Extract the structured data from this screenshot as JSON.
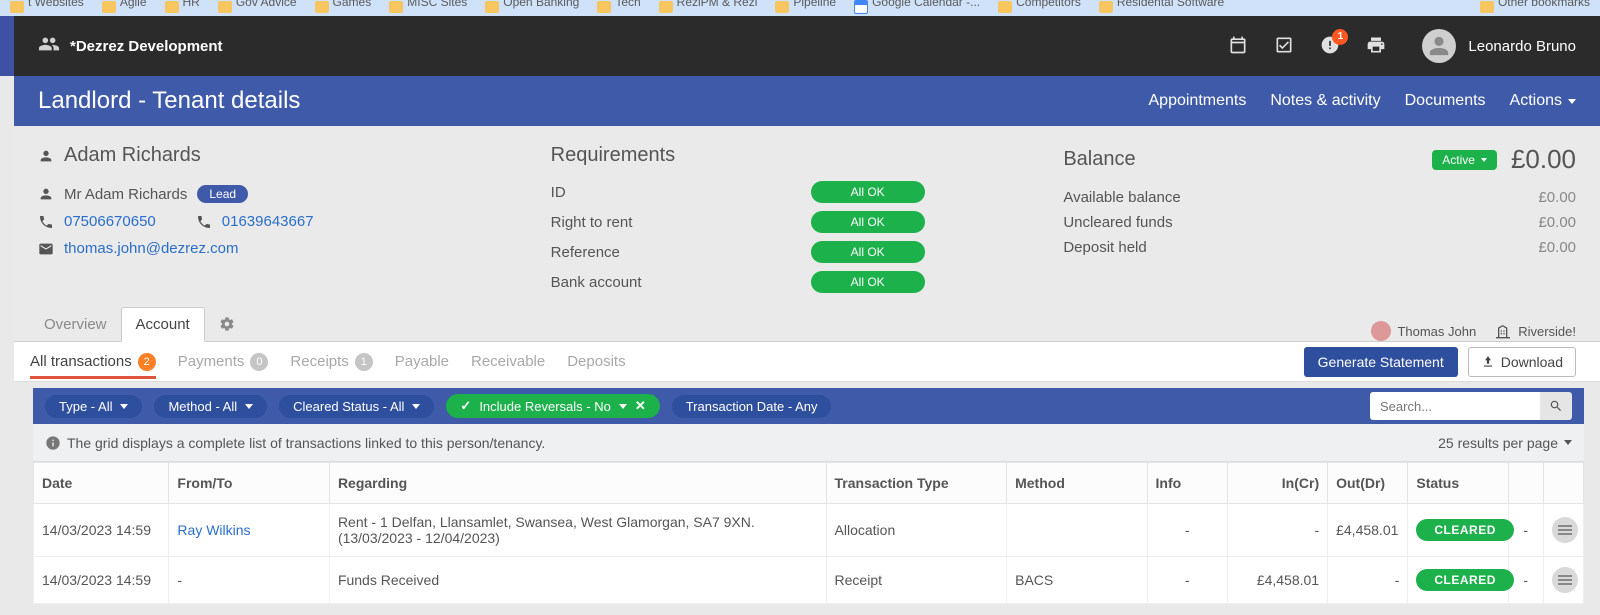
{
  "bookmarks": {
    "left": [
      {
        "label": "t Websites"
      },
      {
        "label": "Agile"
      },
      {
        "label": "HR"
      },
      {
        "label": "Gov Advice"
      },
      {
        "label": "Games"
      },
      {
        "label": "MISC Sites"
      },
      {
        "label": "Open Banking"
      },
      {
        "label": "Tech"
      },
      {
        "label": "ReziPM & Rezi"
      },
      {
        "label": "Pipeline"
      },
      {
        "label": "Google Calendar -...",
        "icon": "calendar"
      },
      {
        "label": "Competitors"
      },
      {
        "label": "Residental Software"
      }
    ],
    "right": [
      {
        "label": "Other bookmarks"
      }
    ]
  },
  "header": {
    "brand": "*Dezrez Development",
    "notif_count": "1",
    "user_name": "Leonardo Bruno"
  },
  "titlebar": {
    "title": "Landlord - Tenant details",
    "actions": {
      "appointments": "Appointments",
      "notes": "Notes & activity",
      "documents": "Documents",
      "actions": "Actions"
    }
  },
  "contact": {
    "name": "Adam Richards",
    "full_name": "Mr Adam Richards",
    "lead_label": "Lead",
    "phone1": "07506670650",
    "phone2": "01639643667",
    "email": "thomas.john@dezrez.com"
  },
  "requirements": {
    "title": "Requirements",
    "rows": [
      {
        "label": "ID",
        "status": "All OK"
      },
      {
        "label": "Right to rent",
        "status": "All OK"
      },
      {
        "label": "Reference",
        "status": "All OK"
      },
      {
        "label": "Bank account",
        "status": "All OK"
      }
    ]
  },
  "balance": {
    "title": "Balance",
    "active_label": "Active",
    "amount": "£0.00",
    "rows": [
      {
        "label": "Available balance",
        "value": "£0.00"
      },
      {
        "label": "Uncleared funds",
        "value": "£0.00"
      },
      {
        "label": "Deposit held",
        "value": "£0.00"
      }
    ]
  },
  "tabs": {
    "overview": "Overview",
    "account": "Account",
    "right_user": "Thomas John",
    "right_office": "Riverside!"
  },
  "subtabs": {
    "all": {
      "label": "All transactions",
      "count": "2"
    },
    "payments": {
      "label": "Payments",
      "count": "0"
    },
    "receipts": {
      "label": "Receipts",
      "count": "1"
    },
    "payable": {
      "label": "Payable"
    },
    "receivable": {
      "label": "Receivable"
    },
    "deposits": {
      "label": "Deposits"
    },
    "generate_btn": "Generate Statement",
    "download_btn": "Download"
  },
  "filters": {
    "type": "Type - All",
    "method": "Method - All",
    "cleared": "Cleared Status - All",
    "reversals": "Include Reversals - No",
    "date": "Transaction Date - Any",
    "search_placeholder": "Search..."
  },
  "grid_info": {
    "text": "The grid displays a complete list of transactions linked to this person/tenancy.",
    "rpp": "25 results per page"
  },
  "table": {
    "headers": {
      "date": "Date",
      "from": "From/To",
      "regarding": "Regarding",
      "type": "Transaction Type",
      "method": "Method",
      "info": "Info",
      "in": "In(Cr)",
      "out": "Out(Dr)",
      "status": "Status"
    },
    "rows": [
      {
        "date": "14/03/2023 14:59",
        "from": "Ray Wilkins",
        "from_link": true,
        "regarding": "Rent - 1 Delfan, Llansamlet, Swansea, West Glamorgan, SA7 9XN. (13/03/2023 - 12/04/2023)",
        "type": "Allocation",
        "method": "",
        "info": "-",
        "in": "-",
        "out": "£4,458.01",
        "status": "CLEARED",
        "blank": "-"
      },
      {
        "date": "14/03/2023 14:59",
        "from": "-",
        "from_link": false,
        "regarding": "Funds Received",
        "type": "Receipt",
        "method": "BACS",
        "info": "-",
        "in": "£4,458.01",
        "out": "-",
        "status": "CLEARED",
        "blank": "-"
      }
    ]
  }
}
